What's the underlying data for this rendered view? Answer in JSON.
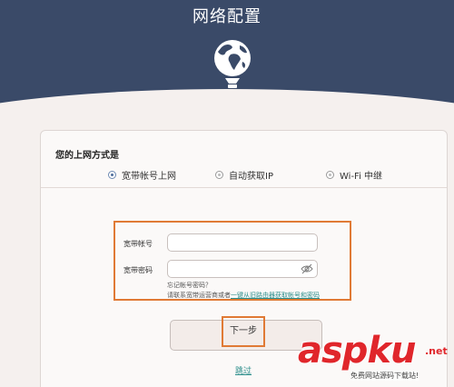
{
  "header": {
    "title": "网络配置"
  },
  "connection": {
    "label": "您的上网方式是",
    "options": [
      {
        "label": "宽带帐号上网",
        "selected": true
      },
      {
        "label": "自动获取IP",
        "selected": false
      },
      {
        "label": "Wi-Fi 中继",
        "selected": false
      }
    ]
  },
  "form": {
    "account_label": "宽带帐号",
    "account_value": "",
    "password_label": "宽带密码",
    "password_value": "",
    "forgot_text": "忘记帐号密码？",
    "contact_text": "请联系宽带运营商或者",
    "import_link": "一键从旧路由器获取帐号和密码"
  },
  "actions": {
    "next_label": "下一步",
    "skip_label": "跳过"
  },
  "watermark": {
    "logo": "aspku",
    "tld": ".net",
    "sub": "免费网站源码下载站!"
  },
  "colors": {
    "header_bg": "#3a4a68",
    "highlight": "#e07a35",
    "link": "#2a8d8a",
    "watermark": "#e0262b"
  }
}
